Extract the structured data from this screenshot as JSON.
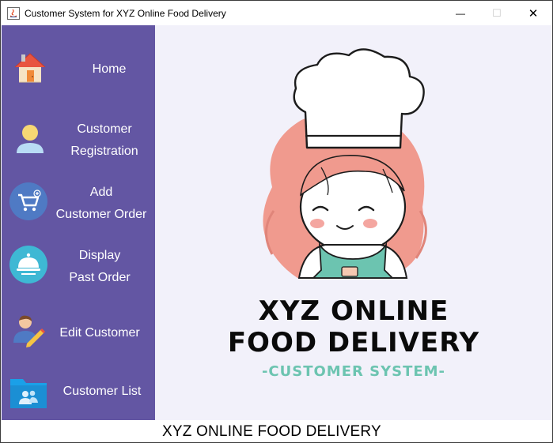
{
  "window": {
    "title": "Customer System for XYZ Online Food Delivery",
    "minimize_glyph": "—",
    "maximize_glyph": "☐",
    "close_glyph": "✕"
  },
  "sidebar": {
    "background": "#6356a3",
    "items": [
      {
        "label_lines": [
          "Home"
        ],
        "icon": "home-icon"
      },
      {
        "label_lines": [
          "Customer",
          "Registration"
        ],
        "icon": "user-icon"
      },
      {
        "label_lines": [
          "Add",
          "Customer Order"
        ],
        "icon": "cart-icon"
      },
      {
        "label_lines": [
          "Display",
          "Past Order"
        ],
        "icon": "cloche-icon"
      },
      {
        "label_lines": [
          "Edit Customer"
        ],
        "icon": "edit-user-icon"
      },
      {
        "label_lines": [
          "Customer List"
        ],
        "icon": "folder-users-icon"
      }
    ]
  },
  "main": {
    "logo_line1": "XYZ ONLINE",
    "logo_line2": "FOOD DELIVERY",
    "logo_subtitle": "-CUSTOMER SYSTEM-",
    "illustration": "chef-girl-illustration"
  },
  "footer": {
    "text": "XYZ ONLINE FOOD DELIVERY"
  }
}
